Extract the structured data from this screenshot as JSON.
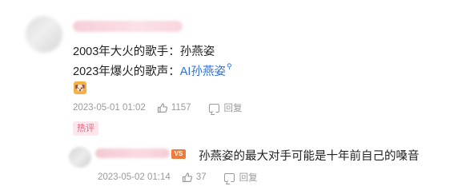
{
  "comment": {
    "line1": "2003年大火的歌手：孙燕姿",
    "line2_prefix": "2023年爆火的歌声：",
    "line2_link": "AI孙燕姿",
    "line2_link_icon": "search-icon",
    "emoji_icon": "dog-face-emoji-icon",
    "date": "2023-05-01 01:02",
    "like_count": "1157",
    "reply_label": "回复",
    "hot_tag": "热评"
  },
  "reply": {
    "badge_text": "VS",
    "text": "孙燕姿的最大对手可能是十年前自己的嗓音",
    "date": "2023-05-02 01:14",
    "like_count": "37",
    "reply_label": "回复"
  },
  "colors": {
    "link": "#2f6fd6",
    "meta_text": "#9a9a9a",
    "hot_tag_text": "#e8637e",
    "hot_tag_bg": "#fde7ec",
    "badge_bg": "#f07a3c"
  }
}
